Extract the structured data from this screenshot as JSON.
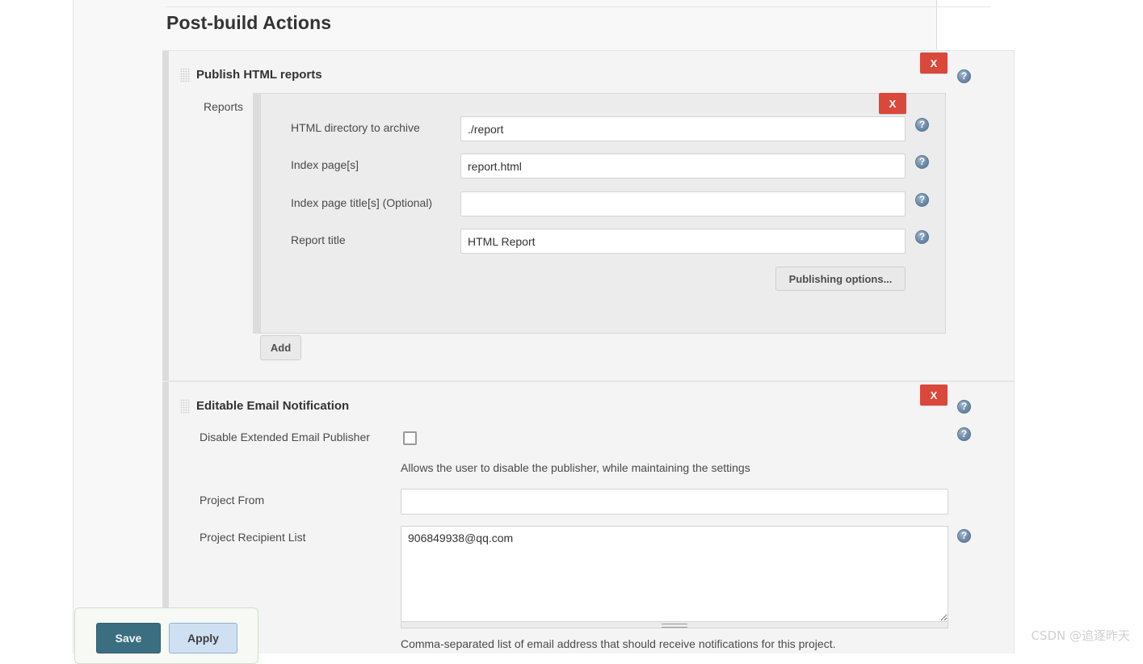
{
  "page": {
    "title": "Post-build Actions",
    "watermark": "CSDN @追逐昨天"
  },
  "icons": {
    "help": "help-circle-icon",
    "delete": "X",
    "drag": "drag-grip-icon"
  },
  "colors": {
    "delete_button": "#d9483b",
    "help_icon": "#6f8ca9",
    "save_button": "#3b6e80",
    "apply_button": "#cfe0f2",
    "panel_bg": "#f4f4f4",
    "inner_panel_bg": "#ececec",
    "content_bg": "#f8f8f8",
    "rail": "#dcdcdc"
  },
  "sections": [
    {
      "id": "publish-html-reports",
      "heading": "Publish HTML reports",
      "delete_label": "X",
      "reports_label": "Reports",
      "add_label": "Add",
      "publishing_options_label": "Publishing options...",
      "fields": [
        {
          "label": "HTML directory to archive",
          "value": "./report",
          "placeholder": ""
        },
        {
          "label": "Index page[s]",
          "value": "report.html",
          "placeholder": ""
        },
        {
          "label": "Index page title[s] (Optional)",
          "value": "",
          "placeholder": ""
        },
        {
          "label": "Report title",
          "value": "HTML Report",
          "placeholder": ""
        }
      ]
    },
    {
      "id": "editable-email-notification",
      "heading": "Editable Email Notification",
      "delete_label": "X",
      "disable_publisher": {
        "label": "Disable Extended Email Publisher",
        "checked": false,
        "description": "Allows the user to disable the publisher, while maintaining the settings"
      },
      "project_from": {
        "label": "Project From",
        "value": "",
        "placeholder": ""
      },
      "project_recipient_list": {
        "label": "Project Recipient List",
        "value": "906849938@qq.com",
        "placeholder": "",
        "description": "Comma-separated list of email address that should receive notifications for this project."
      }
    }
  ],
  "save_bar": {
    "save_label": "Save",
    "apply_label": "Apply"
  }
}
